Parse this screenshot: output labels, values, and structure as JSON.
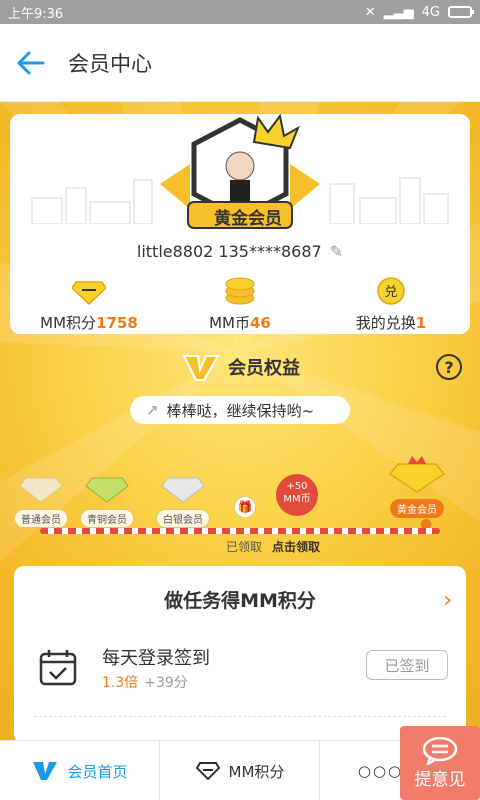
{
  "status": {
    "time": "上午9:36",
    "network": "4G"
  },
  "appbar": {
    "title": "会员中心"
  },
  "profile": {
    "badge_text": "黄金会员",
    "identity": "little8802 135****8687",
    "stats": [
      {
        "label": "MM积分",
        "value": "1758"
      },
      {
        "label": "MM币",
        "value": "46"
      },
      {
        "label": "我的兑换",
        "value": "1"
      }
    ]
  },
  "benefits": {
    "title": "会员权益",
    "slogan": "棒棒哒，继续保持哟~",
    "levels": [
      "普通会员",
      "青铜会员",
      "白银会员",
      "黄金会员"
    ],
    "reward": "+50\nMM币",
    "claimed_label": "已领取",
    "claim_label": "点击领取"
  },
  "tasks": {
    "title": "做任务得MM积分",
    "items": [
      {
        "name": "每天登录签到",
        "multiplier": "1.3倍",
        "points": "+39分",
        "button": "已签到"
      }
    ]
  },
  "tabbar": {
    "items": [
      {
        "label": "会员首页"
      },
      {
        "label": "MM积分"
      },
      {
        "label": "更多"
      }
    ]
  },
  "feedback": {
    "label": "提意见"
  },
  "colors": {
    "accent": "#1a9be6",
    "gold": "#f4b928",
    "orange": "#f07a1a"
  }
}
